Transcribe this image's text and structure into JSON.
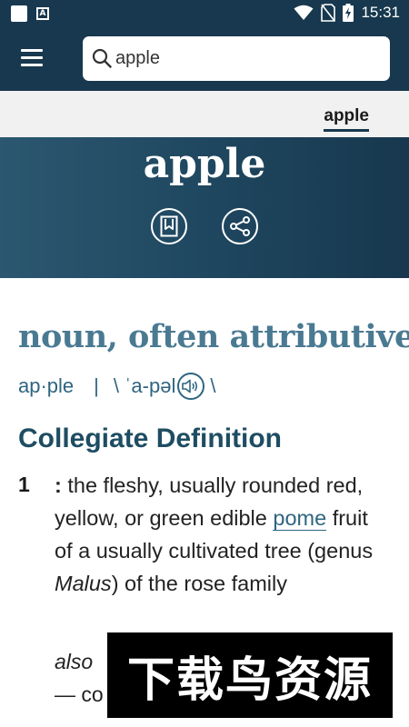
{
  "status_bar": {
    "time": "15:31",
    "notification_icon": "a-square-icon",
    "icons": [
      "wifi-icon",
      "no-sim-icon",
      "battery-charging-icon"
    ]
  },
  "search": {
    "value": "apple",
    "placeholder": ""
  },
  "tabs": {
    "active_label": "apple"
  },
  "entry": {
    "headword": "apple",
    "part_of_speech": "noun, often attributive",
    "syllables": "ap·ple",
    "separator": "|",
    "pron_open": "\\ ˈa-pəl",
    "pron_close": "\\"
  },
  "section": {
    "title": "Collegiate Definition"
  },
  "definition": {
    "number": "1",
    "colon": ":",
    "text_1": "the fleshy, usually rounded red, yellow, or green edible",
    "link": "pome",
    "text_2": "fruit of a usually cultivated tree (genus",
    "genus": "Malus",
    "text_3": ") of the rose family",
    "also": "also",
    "dash": "— co"
  },
  "watermark": {
    "text": "下载鸟资源"
  },
  "colors": {
    "header_bg": "#17384e",
    "accent": "#2f6580",
    "pos_color": "#4a7a92",
    "tab_bg": "#f1f1f1"
  }
}
